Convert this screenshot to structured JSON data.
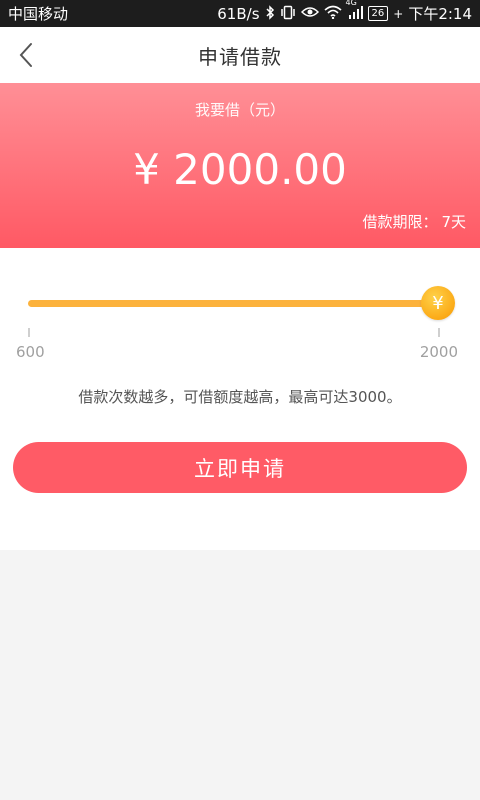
{
  "status_bar": {
    "carrier": "中国移动",
    "net_speed": "61B/s",
    "signal_label": "4G",
    "battery": "26",
    "time": "下午2:14"
  },
  "header": {
    "title": "申请借款"
  },
  "hero": {
    "label": "我要借（元）",
    "amount": "¥ 2000.00",
    "term_label": "借款期限：",
    "term_value": "7天"
  },
  "slider": {
    "min_label": "600",
    "max_label": "2000",
    "min": 600,
    "max": 2000,
    "value": 2000,
    "knob_symbol": "¥",
    "color": "#fcb23c"
  },
  "note": "借款次数越多，可借额度越高，最高可达3000。",
  "apply_button": {
    "label": "立即申请",
    "color": "#ff5b66"
  },
  "icons": {
    "back": "chevron-left-icon",
    "bluetooth": "bluetooth-icon",
    "vibrate": "vibrate-icon",
    "eye": "eye-icon",
    "wifi": "wifi-icon",
    "signal": "signal-icon",
    "battery": "battery-icon"
  }
}
